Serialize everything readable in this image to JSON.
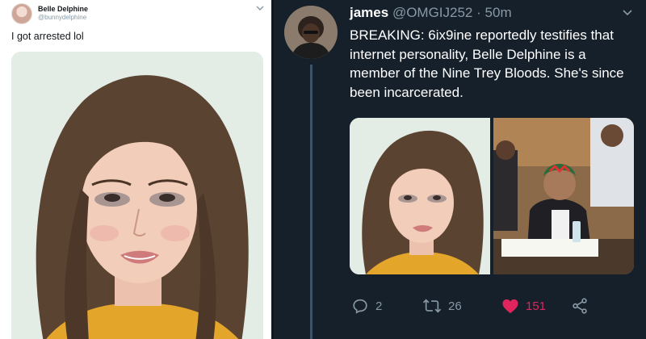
{
  "left_tweet": {
    "author_name": "Belle Delphine",
    "author_handle": "@bunnydelphine",
    "text": "I got arrested lol"
  },
  "right_tweet": {
    "author_name": "james",
    "author_handle": "@OMGIJ252",
    "separator": "·",
    "time": "50m",
    "text": "BREAKING: 6ix9ine reportedly testifies that internet personality, Belle Delphine is a member of the Nine Trey Bloods. She's since been incarcerated.",
    "actions": {
      "reply_count": "2",
      "retweet_count": "26",
      "like_count": "151"
    }
  },
  "colors": {
    "dark_bg": "#15202b",
    "muted": "#8899a6",
    "like": "#e0245e"
  }
}
